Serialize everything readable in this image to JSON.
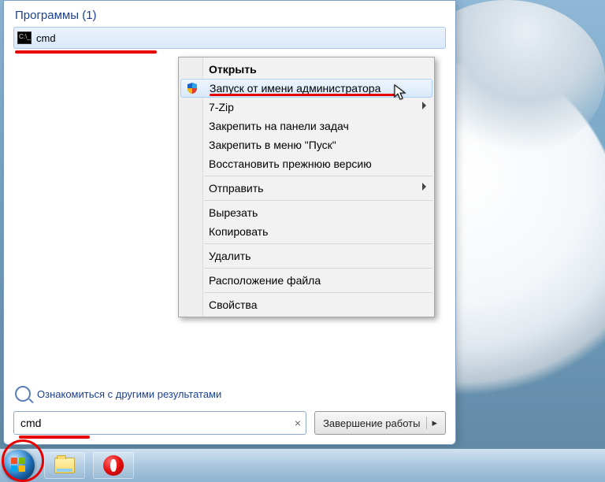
{
  "startmenu": {
    "programs_header": "Программы (1)",
    "result_label": "cmd",
    "more_results": "Ознакомиться с другими результатами",
    "search_value": "cmd",
    "shutdown_label": "Завершение работы"
  },
  "context_menu": {
    "open": "Открыть",
    "run_as_admin": "Запуск от имени администратора",
    "seven_zip": "7-Zip",
    "pin_taskbar": "Закрепить на панели задач",
    "pin_start": "Закрепить в меню \"Пуск\"",
    "restore_prev": "Восстановить прежнюю версию",
    "send_to": "Отправить",
    "cut": "Вырезать",
    "copy": "Копировать",
    "delete": "Удалить",
    "open_location": "Расположение файла",
    "properties": "Свойства"
  }
}
